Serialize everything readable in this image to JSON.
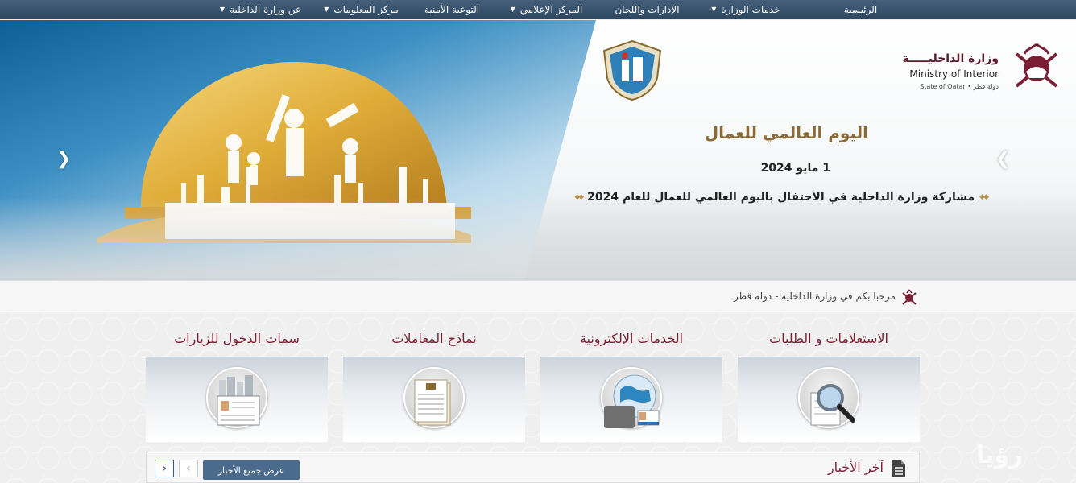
{
  "nav": {
    "items": [
      {
        "label": "الرئيسية",
        "has_dropdown": false
      },
      {
        "label": "خدمات الوزارة",
        "has_dropdown": true
      },
      {
        "label": "الإدارات واللجان",
        "has_dropdown": false
      },
      {
        "label": "المركز الإعلامي",
        "has_dropdown": true
      },
      {
        "label": "التوعية الأمنية",
        "has_dropdown": false
      },
      {
        "label": "مركز المعلومات",
        "has_dropdown": true
      },
      {
        "label": "عن وزارة الداخلية",
        "has_dropdown": true
      }
    ]
  },
  "logo": {
    "ar_name": "وزارة الداخليـــــة",
    "en_name": "Ministry of Interior",
    "state": "State of Qatar • دولة قطر"
  },
  "slide": {
    "title": "اليوم العالمي للعمال",
    "date": "1 مايو 2024",
    "caption": "مشاركة وزارة الداخلية في الاحتفال باليوم العالمي للعمال للعام 2024",
    "prev_icon": "chevron-left-icon",
    "next_icon": "chevron-right-icon"
  },
  "welcome": {
    "text": "مرحبا بكم في وزارة الداخلية - دولة قطر"
  },
  "tiles": [
    {
      "title": "الاستعلامات و الطلبات",
      "icon": "magnifier-icon"
    },
    {
      "title": "الخدمات الإلكترونية",
      "icon": "globe-card-icon"
    },
    {
      "title": "نماذج المعاملات",
      "icon": "forms-icon"
    },
    {
      "title": "سمات الدخول للزيارات",
      "icon": "visa-documents-icon"
    }
  ],
  "news": {
    "title": "آخر الأخبار",
    "view_all": "عرض جميع الأخبار"
  },
  "colors": {
    "nav_bg": "#3a5572",
    "maroon": "#7a1f33",
    "gold": "#8b6a36",
    "button_blue": "#4b6b8c"
  }
}
